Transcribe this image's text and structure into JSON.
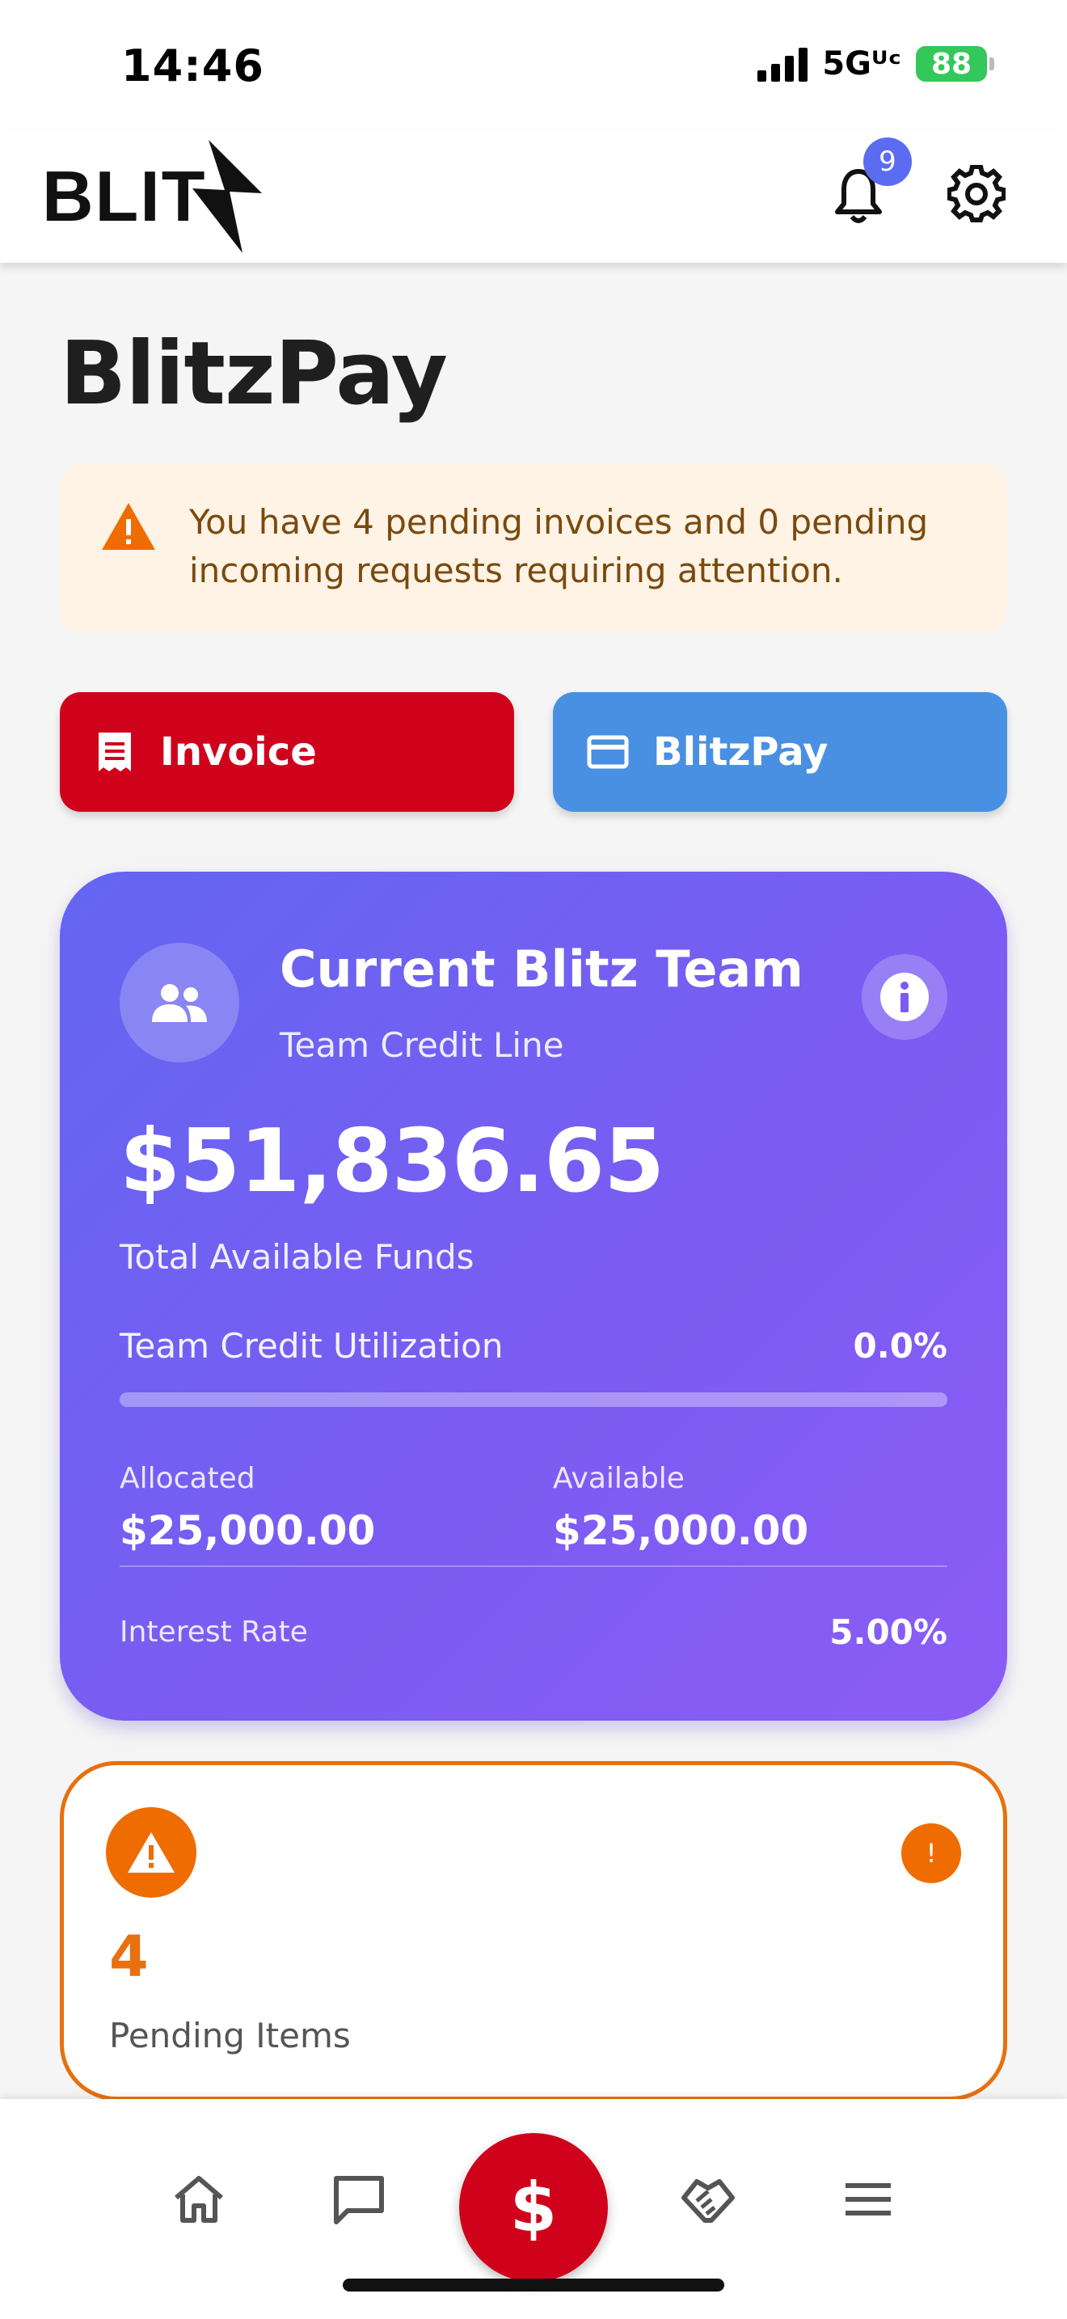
{
  "status_bar": {
    "time": "14:46",
    "network": "5Gᵁᶜ",
    "battery": "88"
  },
  "header": {
    "logo_text": "BLIT",
    "notification_count": "9"
  },
  "page": {
    "title": "BlitzPay"
  },
  "alert": {
    "message": "You have 4 pending invoices and 0 pending incoming requests requiring attention."
  },
  "actions": {
    "invoice_label": "Invoice",
    "blitzpay_label": "BlitzPay"
  },
  "credit_card": {
    "team_name": "Current Blitz Team",
    "subtitle": "Team Credit Line",
    "amount": "$51,836.65",
    "amount_label": "Total Available Funds",
    "utilization_label": "Team Credit Utilization",
    "utilization_value": "0.0%",
    "utilization_fraction": 0.0,
    "allocated_label": "Allocated",
    "allocated_value": "$25,000.00",
    "available_label": "Available",
    "available_value": "$25,000.00",
    "interest_label": "Interest Rate",
    "interest_value": "5.00%"
  },
  "pending": {
    "count": "4",
    "label": "Pending Items",
    "badge": "!"
  },
  "bottom_nav": {
    "center_symbol": "$",
    "items": [
      "home-icon",
      "chat-icon",
      "dollar-icon",
      "handshake-icon",
      "menu-icon"
    ]
  },
  "colors": {
    "brand_red": "#d0021b",
    "blitzpay_blue": "#4a90e2",
    "card_gradient_start": "#6366f1",
    "card_gradient_end": "#8b5cf6",
    "warning_orange": "#e8700e",
    "badge_blue": "#5b6cf0"
  }
}
